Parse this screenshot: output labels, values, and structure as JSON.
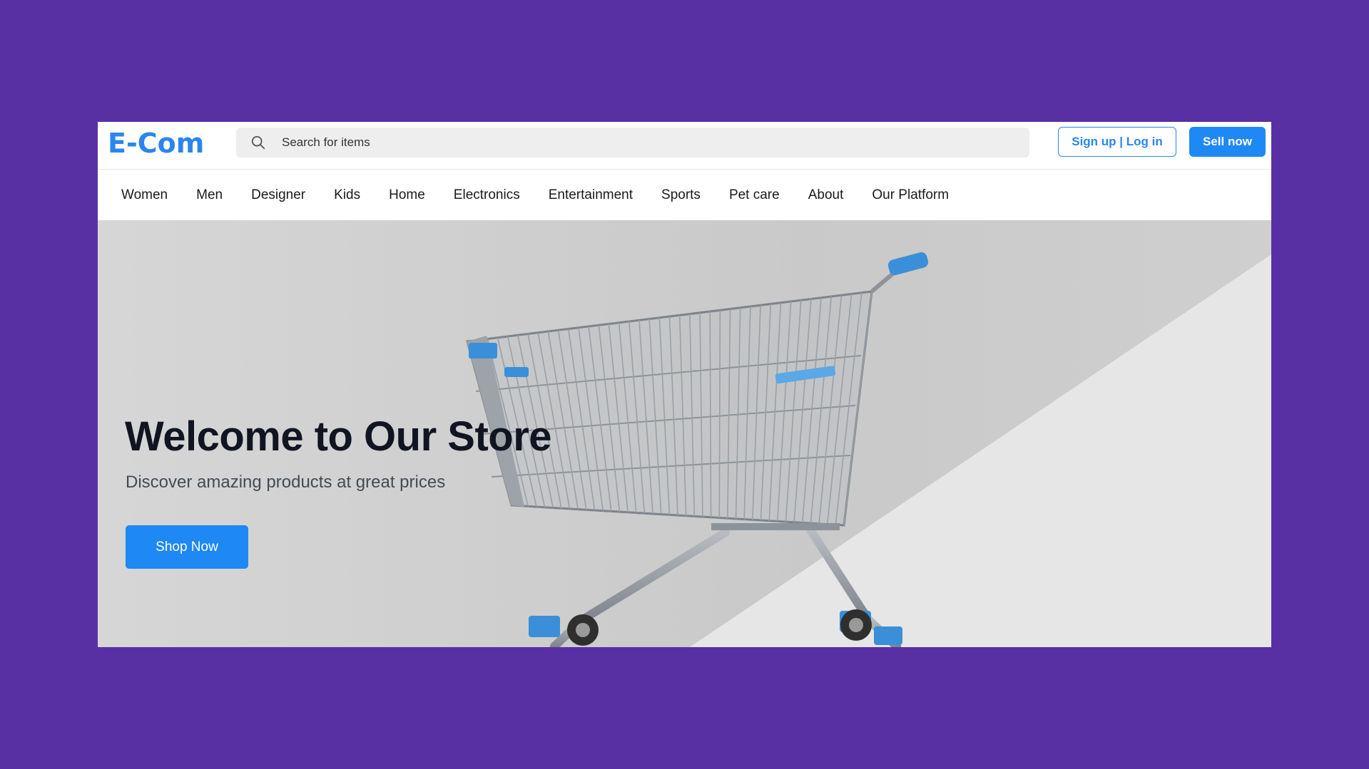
{
  "header": {
    "logo_text": "E-Com",
    "search": {
      "placeholder": "Search for items",
      "icon": "search-icon"
    },
    "signup_login_label": "Sign up | Log in",
    "sell_now_label": "Sell now"
  },
  "nav": {
    "items": [
      {
        "label": "Women"
      },
      {
        "label": "Men"
      },
      {
        "label": "Designer"
      },
      {
        "label": "Kids"
      },
      {
        "label": "Home"
      },
      {
        "label": "Electronics"
      },
      {
        "label": "Entertainment"
      },
      {
        "label": "Sports"
      },
      {
        "label": "Pet care"
      },
      {
        "label": "About"
      },
      {
        "label": "Our Platform"
      }
    ]
  },
  "hero": {
    "title": "Welcome to Our Store",
    "subtitle": "Discover amazing products at great prices",
    "cta_label": "Shop Now",
    "image": "shopping-cart-image"
  },
  "colors": {
    "page_background": "#5930a4",
    "accent": "#1e88f5",
    "logo": "#2a85f0"
  }
}
